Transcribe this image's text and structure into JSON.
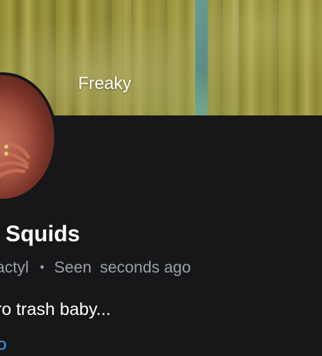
{
  "banner": {
    "title": "Freaky"
  },
  "profile": {
    "name": "Squids",
    "status_prefix": "actyl",
    "separator": "•",
    "seen_label": "Seen",
    "seen_time": "seconds ago",
    "bio": "ro trash baby...",
    "link_text": "o"
  },
  "colors": {
    "background": "#17171a",
    "text_primary": "#ffffff",
    "text_secondary": "#9aa0a8",
    "link": "#3ea6ff"
  },
  "icons": {
    "avatar": "profile-avatar"
  }
}
